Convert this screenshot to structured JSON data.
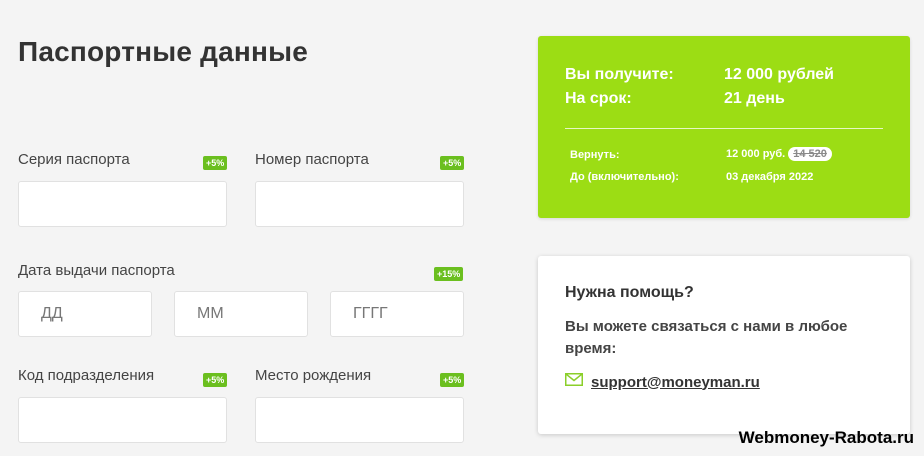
{
  "page_title": "Паспортные данные",
  "fields": {
    "passport_series": {
      "label": "Серия паспорта",
      "bonus": "+5%",
      "value": ""
    },
    "passport_number": {
      "label": "Номер паспорта",
      "bonus": "+5%",
      "value": ""
    },
    "issue_date": {
      "label": "Дата выдачи паспорта",
      "bonus": "+15%",
      "day_placeholder": "ДД",
      "month_placeholder": "ММ",
      "year_placeholder": "ГГГГ"
    },
    "division_code": {
      "label": "Код подразделения",
      "bonus": "+5%",
      "value": ""
    },
    "birthplace": {
      "label": "Место рождения",
      "bonus": "+5%",
      "value": ""
    }
  },
  "summary": {
    "receive_label": "Вы получите:",
    "receive_value": "12 000 рублей",
    "term_label": "На срок:",
    "term_value": "21 день",
    "return_label": "Вернуть:",
    "return_value": "12 000 руб.",
    "return_old_value": "14 520",
    "due_label": "До (включительно):",
    "due_value": "03 декабря 2022",
    "background_color": "#9cdd14"
  },
  "help": {
    "title": "Нужна помощь?",
    "text": "Вы можете связаться с нами в любое время:",
    "email": "support@moneyman.ru",
    "email_icon": "envelope-icon"
  },
  "watermark": "Webmoney-Rabota.ru",
  "accent_color": "#6bbf1f"
}
